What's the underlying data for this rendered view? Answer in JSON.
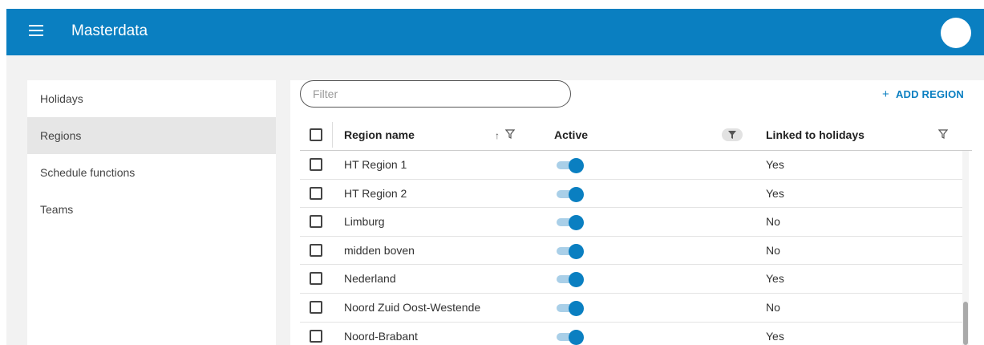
{
  "header": {
    "title": "Masterdata",
    "menu_icon": "hamburger-menu-icon",
    "avatar": "user-avatar"
  },
  "sidebar": {
    "items": [
      {
        "label": "Holidays",
        "active": false
      },
      {
        "label": "Regions",
        "active": true
      },
      {
        "label": "Schedule functions",
        "active": false
      },
      {
        "label": "Teams",
        "active": false
      }
    ]
  },
  "toolbar": {
    "filter_placeholder": "Filter",
    "add_region_label": "ADD REGION",
    "add_icon": "plus-icon"
  },
  "table": {
    "columns": {
      "region_name": "Region name",
      "active": "Active",
      "linked": "Linked to holidays"
    },
    "rows": [
      {
        "name": "HT Region 1",
        "active": true,
        "linked": "Yes"
      },
      {
        "name": "HT Region 2",
        "active": true,
        "linked": "Yes"
      },
      {
        "name": "Limburg",
        "active": true,
        "linked": "No"
      },
      {
        "name": "midden boven",
        "active": true,
        "linked": "No"
      },
      {
        "name": "Nederland",
        "active": true,
        "linked": "Yes"
      },
      {
        "name": "Noord Zuid Oost-Westende",
        "active": true,
        "linked": "No"
      },
      {
        "name": "Noord-Brabant",
        "active": true,
        "linked": "Yes"
      }
    ]
  },
  "colors": {
    "primary": "#0a7fc1",
    "toggle_track": "#a9cfe8",
    "content_bg": "#f2f2f2"
  }
}
